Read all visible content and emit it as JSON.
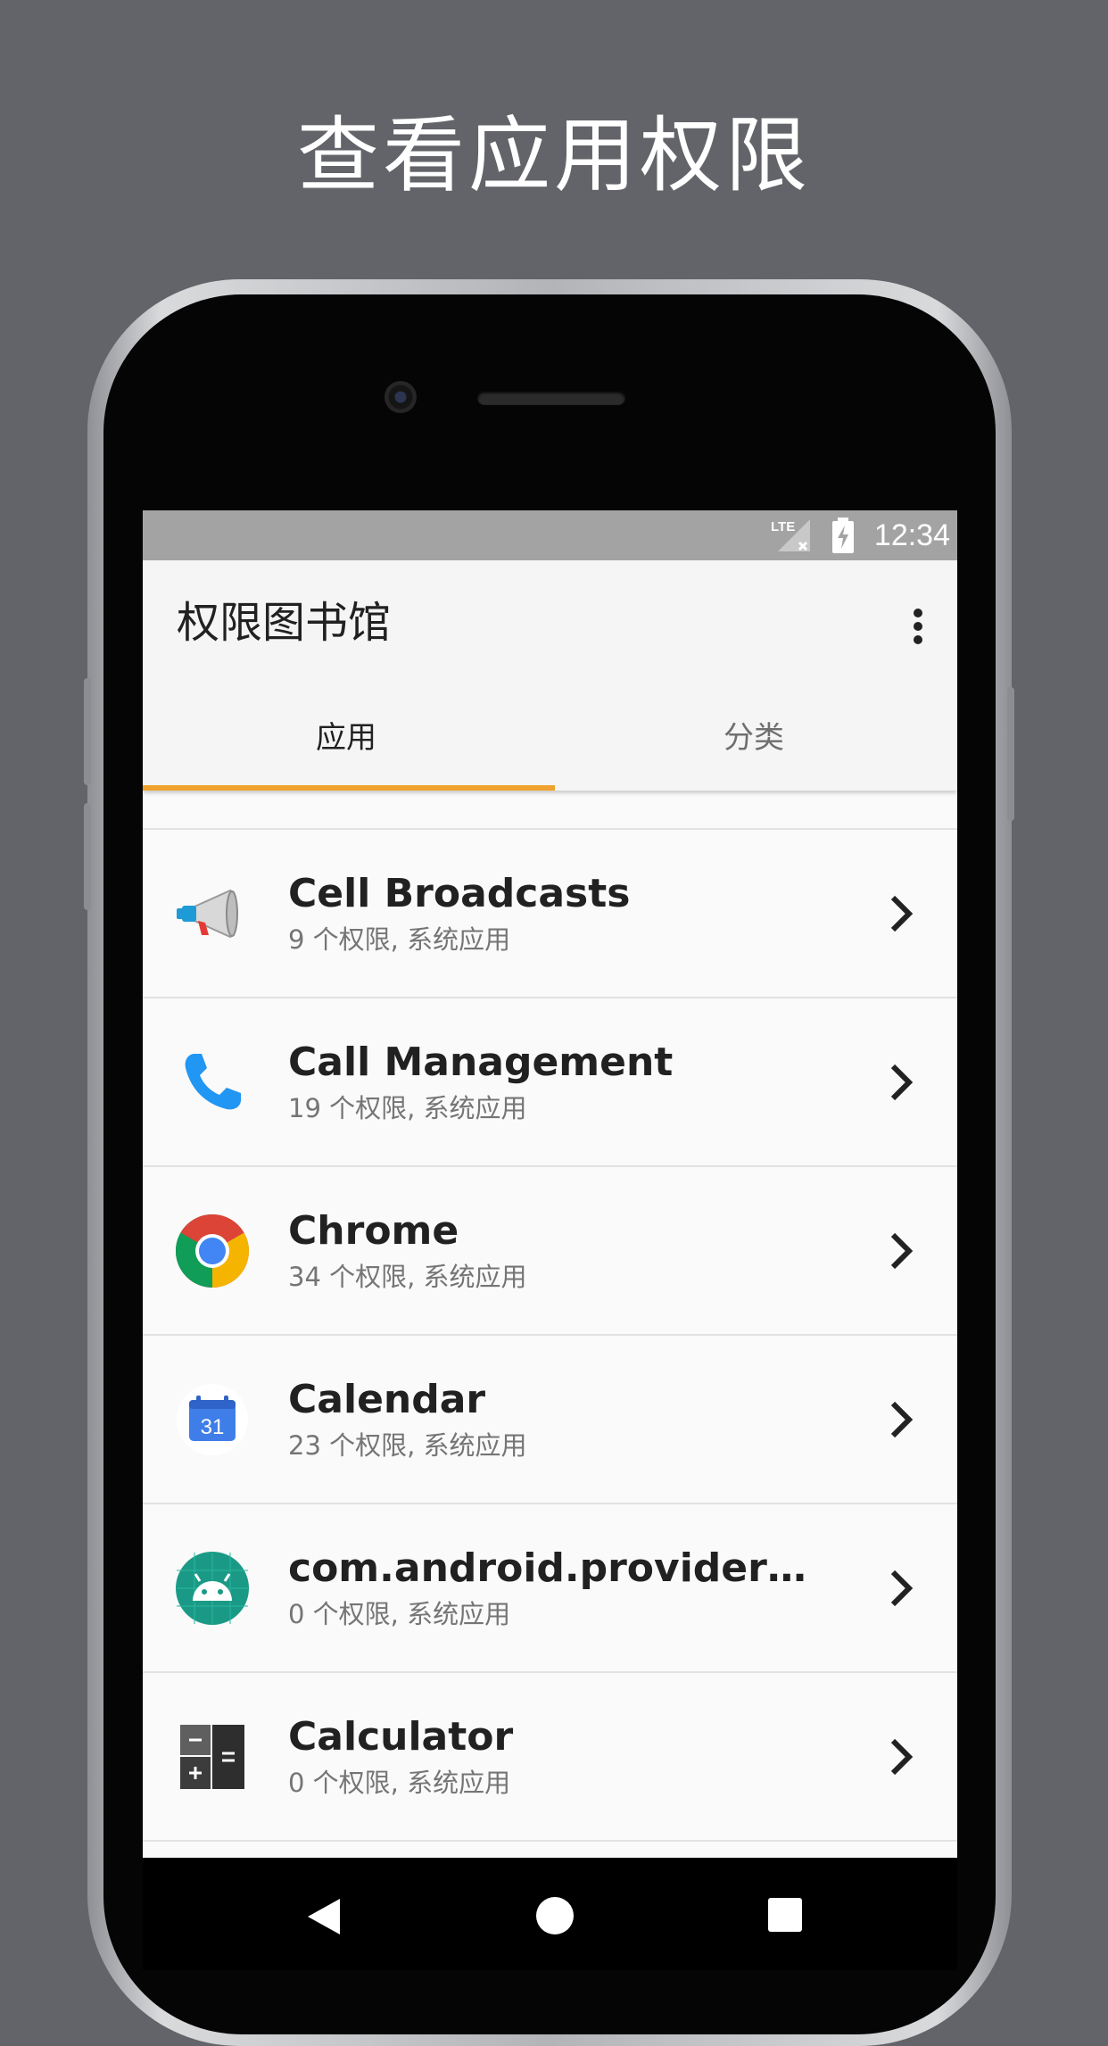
{
  "promo": {
    "title": "查看应用权限"
  },
  "status_bar": {
    "time": "12:34",
    "network": "LTE"
  },
  "toolbar": {
    "title": "权限图书馆",
    "overflow_icon": "more-vert-icon"
  },
  "tabs": [
    {
      "label": "应用",
      "selected": true
    },
    {
      "label": "分类",
      "selected": false
    }
  ],
  "accent_color": "#f0a22e",
  "apps": [
    {
      "name": "Cell Broadcasts",
      "subtitle": "9 个权限, 系统应用",
      "icon": "megaphone-icon"
    },
    {
      "name": "Call Management",
      "subtitle": "19 个权限, 系统应用",
      "icon": "phone-icon"
    },
    {
      "name": "Chrome",
      "subtitle": "34 个权限, 系统应用",
      "icon": "chrome-icon"
    },
    {
      "name": "Calendar",
      "subtitle": "23 个权限, 系统应用",
      "icon": "calendar-icon",
      "icon_text": "31"
    },
    {
      "name": "com.android.providers.par…",
      "subtitle": "0 个权限, 系统应用",
      "icon": "android-icon"
    },
    {
      "name": "Calculator",
      "subtitle": "0 个权限, 系统应用",
      "icon": "calculator-icon"
    }
  ]
}
